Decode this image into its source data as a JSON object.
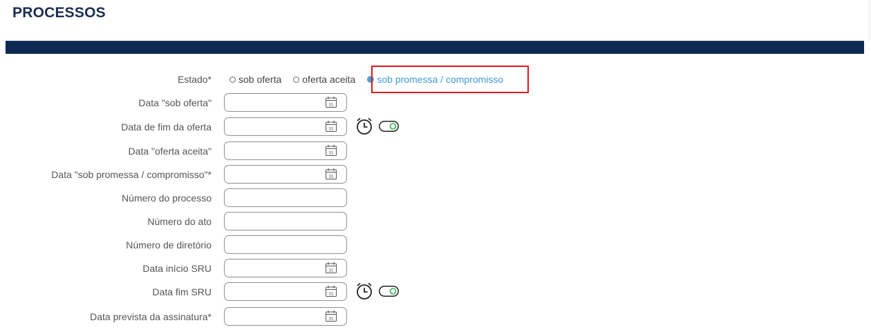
{
  "page": {
    "title": "PROCESSOS"
  },
  "estado": {
    "label": "Estado*",
    "options": [
      {
        "label": "sob oferta",
        "selected": false
      },
      {
        "label": "oferta aceita",
        "selected": false
      },
      {
        "label": "sob promessa / compromisso",
        "selected": true
      }
    ]
  },
  "fields": {
    "data_sob_oferta": {
      "label": "Data \"sob oferta\"",
      "value": ""
    },
    "data_fim_oferta": {
      "label": "Data de fim da oferta",
      "value": ""
    },
    "data_oferta_aceita": {
      "label": "Data \"oferta aceita\"",
      "value": ""
    },
    "data_sob_promessa": {
      "label": "Data \"sob promessa / compromisso\"*",
      "value": ""
    },
    "numero_processo": {
      "label": "Número do processo",
      "value": ""
    },
    "numero_ato": {
      "label": "Número do ato",
      "value": ""
    },
    "numero_diretorio": {
      "label": "Número de diretório",
      "value": ""
    },
    "data_inicio_sru": {
      "label": "Data início SRU",
      "value": ""
    },
    "data_fim_sru": {
      "label": "Data fim SRU",
      "value": ""
    },
    "data_prevista_assinatura": {
      "label": "Data prevista da assinatura*",
      "value": ""
    }
  },
  "icons": {
    "calendar": "calendar-icon",
    "alarm": "alarm-clock-icon",
    "toggle": "toggle-switch"
  },
  "colors": {
    "header_bar": "#0f2a52",
    "title": "#1a2e52",
    "selected_radio": "#4aa3d9",
    "highlight": "#e2141b",
    "toggle_dot": "#2fb34a"
  }
}
